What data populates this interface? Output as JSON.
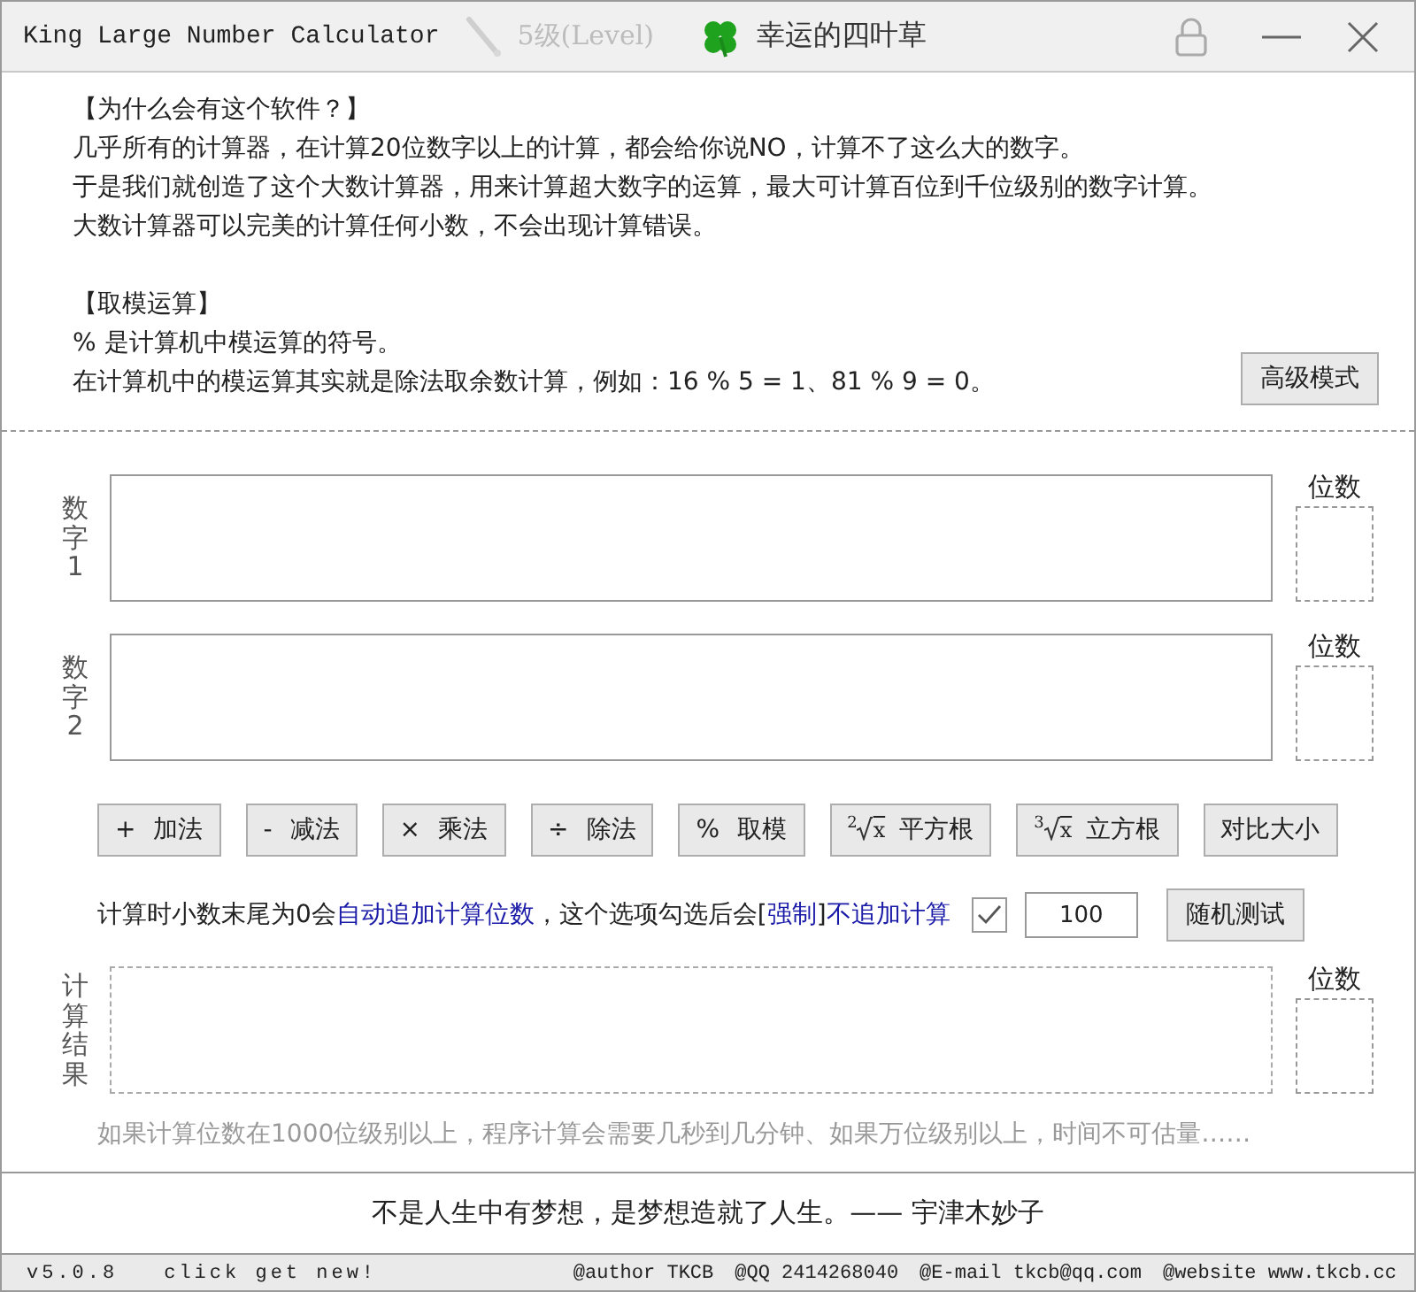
{
  "title_bar": {
    "title": "King Large Number Calculator",
    "level": "5级(Level)",
    "lucky": "幸运的四叶草",
    "locked": true
  },
  "intro": {
    "heading": "【为什么会有这个软件？】",
    "lines": [
      "几乎所有的计算器，在计算20位数字以上的计算，都会给你说NO，计算不了这么大的数字。",
      "于是我们就创造了这个大数计算器，用来计算超大数字的运算，最大可计算百位到千位级别的数字计算。",
      "大数计算器可以完美的计算任何小数，不会出现计算错误。"
    ],
    "mod_heading": "【取模运算】",
    "mod_lines": [
      "% 是计算机中模运算的符号。",
      "在计算机中的模运算其实就是除法取余数计算，例如：16 % 5 = 1、81 % 9 = 0。"
    ],
    "advanced_button": "高级模式"
  },
  "inputs": [
    {
      "label": "数字1",
      "digits_label": "位数"
    },
    {
      "label": "数字2",
      "digits_label": "位数"
    }
  ],
  "operations": [
    {
      "kind": "symbol",
      "symbol": "+",
      "label": "加法"
    },
    {
      "kind": "symbol",
      "symbol": "-",
      "label": "减法"
    },
    {
      "kind": "symbol",
      "symbol": "×",
      "label": "乘法"
    },
    {
      "kind": "symbol",
      "symbol": "÷",
      "label": "除法"
    },
    {
      "kind": "symbol",
      "symbol": "%",
      "label": "取模"
    },
    {
      "kind": "root",
      "index": "2",
      "radicand": "x",
      "label": "平方根"
    },
    {
      "kind": "root",
      "index": "3",
      "radicand": "x",
      "label": "立方根"
    },
    {
      "kind": "plain",
      "label": "对比大小"
    }
  ],
  "option": {
    "parts": [
      {
        "kind": "plain",
        "text": "计算时小数末尾为0会"
      },
      {
        "kind": "link",
        "text": "自动追加计算位数"
      },
      {
        "kind": "plain",
        "text": "，这个选项勾选后会["
      },
      {
        "kind": "link",
        "text": "强制"
      },
      {
        "kind": "plain",
        "text": "]"
      },
      {
        "kind": "link",
        "text": "不追加计算"
      }
    ],
    "checked": true,
    "value": "100",
    "random_button": "随机测试"
  },
  "result": {
    "label": "计算结果",
    "digits_label": "位数",
    "note": "如果计算位数在1000位级别以上，程序计算会需要几秒到几分钟、如果万位级别以上，时间不可估量……"
  },
  "quote": "不是人生中有梦想，是梦想造就了人生。—— 宇津木妙子",
  "status_bar": {
    "version": "v5.0.8",
    "update_link": "click get new!",
    "items": [
      "@author TKCB",
      "@QQ 2414268040",
      "@E-mail tkcb@qq.com",
      "@website www.tkcb.cc"
    ]
  }
}
